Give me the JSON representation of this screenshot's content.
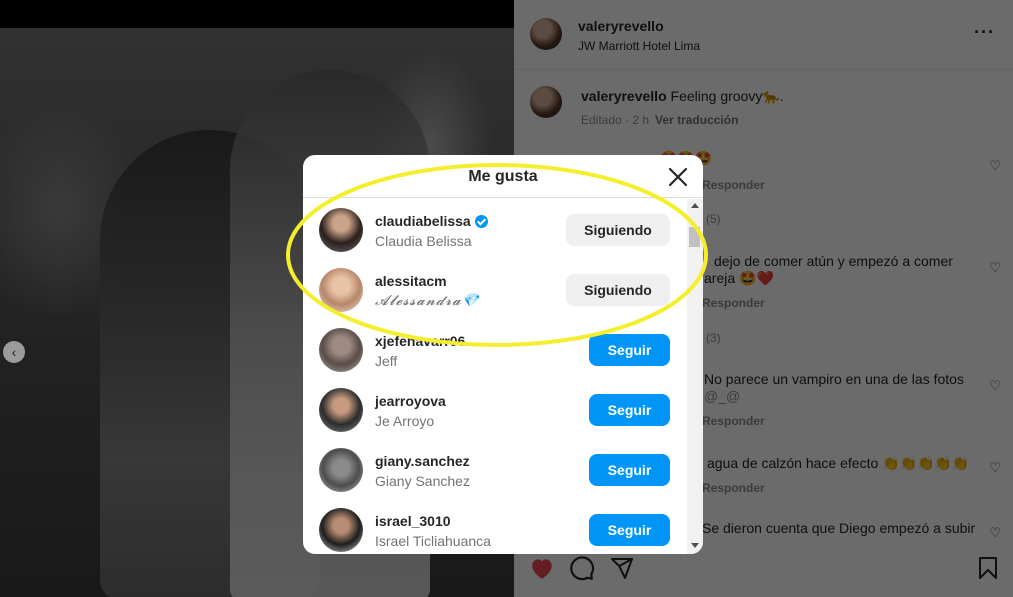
{
  "post": {
    "username": "valeryrevello",
    "location": "JW Marriott Hotel Lima",
    "more_icon": "ellipsis-icon",
    "caption_user": "valeryrevello",
    "caption_text": "Feeling groovy🐆.",
    "caption_edited": "Editado · 2 h",
    "caption_translate": "Ver traducción"
  },
  "comments": [
    {
      "text": "🤩🤩🤩",
      "reply": "Responder"
    },
    {
      "text": "(5)"
    },
    {
      "text": "dejo de comer atún y empezó a comer",
      "text2": "areja 🤩❤️",
      "reply": "Responder"
    },
    {
      "text": "(3)"
    },
    {
      "text": "No parece un vampiro en una de las fotos",
      "text2": "@_@",
      "reply": "Responder"
    },
    {
      "text": "agua de calzón hace efecto 👏👏👏👏👏",
      "reply": "Responder"
    },
    {
      "text": "Se dieron cuenta que Diego empezó a subir"
    }
  ],
  "modal": {
    "title": "Me gusta",
    "close_icon": "close-icon",
    "likes": [
      {
        "username": "claudiabelissa",
        "fullname": "Claudia Belissa",
        "verified": true,
        "button": "Siguiendo",
        "following": true
      },
      {
        "username": "alessitacm",
        "fullname": "𝓐𝓵𝓮𝓼𝓼𝓪𝓷𝓭𝓻𝓪💎",
        "verified": false,
        "button": "Siguiendo",
        "following": true
      },
      {
        "username": "xjefenavarr06",
        "fullname": "Jeff",
        "verified": false,
        "button": "Seguir",
        "following": false
      },
      {
        "username": "jearroyova",
        "fullname": "Je Arroyo",
        "verified": false,
        "button": "Seguir",
        "following": false
      },
      {
        "username": "giany.sanchez",
        "fullname": "Giany Sanchez",
        "verified": false,
        "button": "Seguir",
        "following": false
      },
      {
        "username": "israel_3010",
        "fullname": "Israel Ticliahuanca",
        "verified": false,
        "button": "Seguir",
        "following": false
      }
    ]
  },
  "actions": {
    "like_icon": "heart-filled-icon",
    "comment_icon": "comment-icon",
    "share_icon": "send-icon",
    "save_icon": "bookmark-icon"
  },
  "colors": {
    "accent": "#0095f6",
    "highlight": "#f5ee2c",
    "like_red": "#ed4956"
  }
}
